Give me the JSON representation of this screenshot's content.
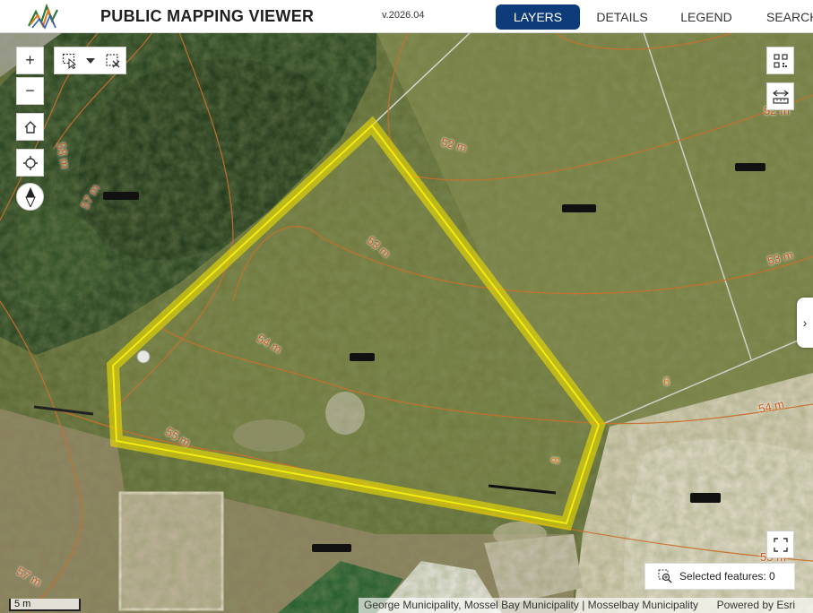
{
  "header": {
    "title": "PUBLIC MAPPING VIEWER",
    "version": "v.2026.04",
    "tabs": [
      {
        "label": "LAYERS",
        "active": true
      },
      {
        "label": "DETAILS",
        "active": false
      },
      {
        "label": "LEGEND",
        "active": false
      },
      {
        "label": "SEARCH",
        "active": false
      }
    ]
  },
  "map": {
    "controls": {
      "zoom_in": "+",
      "zoom_out": "−"
    },
    "contour_labels": [
      "58 m",
      "57 m",
      "52 m",
      "52 m",
      "53 m",
      "53 m",
      "54 m",
      "55 m",
      "54 m",
      "57 m",
      "55 m"
    ],
    "erf_labels": [
      "6",
      "8"
    ],
    "selected_features": "Selected features: 0",
    "scale": "5 m",
    "attribution": "George Municipality, Mossel Bay Municipality | Mosselbay Municipality",
    "powered_by": "Powered by Esri",
    "expand_arrow": "›"
  },
  "colors": {
    "active_tab": "#0e3c7a",
    "parcel_highlight": "#f0e000",
    "contour": "#c8702c"
  }
}
